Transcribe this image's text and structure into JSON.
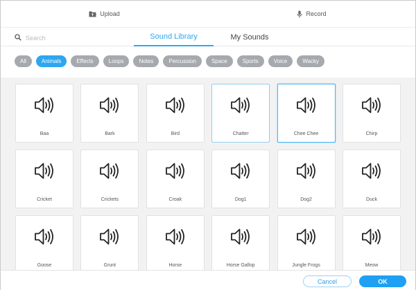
{
  "topbar": {
    "upload_label": "Upload",
    "record_label": "Record"
  },
  "search": {
    "placeholder": "Search"
  },
  "tabs": [
    {
      "label": "Sound Library",
      "active": true
    },
    {
      "label": "My Sounds",
      "active": false
    }
  ],
  "categories": [
    "All",
    "Animals",
    "Effects",
    "Loops",
    "Notes",
    "Percussion",
    "Space",
    "Sports",
    "Voice",
    "Wacky"
  ],
  "active_category": "Animals",
  "sounds": [
    "Baa",
    "Bark",
    "Bird",
    "Chatter",
    "Chee Chee",
    "Chirp",
    "Cricket",
    "Crickets",
    "Croak",
    "Dog1",
    "Dog2",
    "Duck",
    "Goose",
    "Grunt",
    "Horse",
    "Horse Gallop",
    "Jungle Frogs",
    "Meow"
  ],
  "selected_sound": "Chee Chee",
  "hovered_sound": "Chatter",
  "footer": {
    "cancel_label": "Cancel",
    "ok_label": "OK"
  },
  "colors": {
    "accent": "#2ea6f0",
    "pill_inactive": "#a6a9ae",
    "grid_bg": "#f2f2f2"
  }
}
